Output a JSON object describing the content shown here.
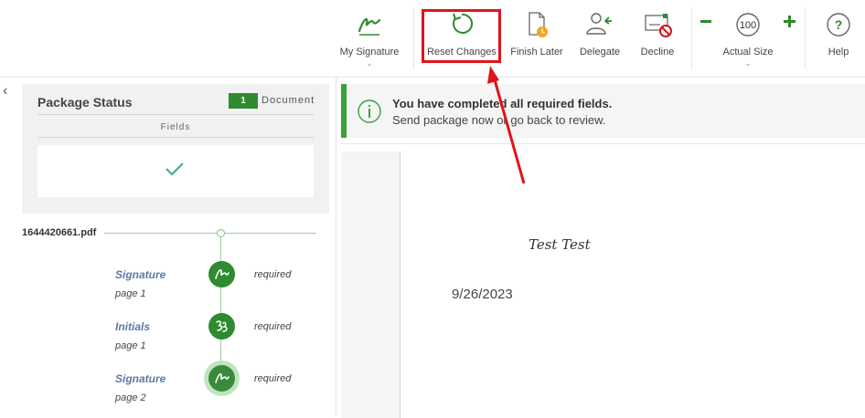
{
  "toolbar": {
    "my_signature": "My Signature",
    "reset_changes": "Reset Changes",
    "finish_later": "Finish Later",
    "delegate": "Delegate",
    "decline": "Decline",
    "zoom_value": "100",
    "actual_size": "Actual Size",
    "help": "Help"
  },
  "package_status": {
    "title": "Package Status",
    "document_count": "1",
    "document_label": "Document",
    "fields_label": "Fields"
  },
  "file": {
    "name": "1644420661.pdf",
    "fields": [
      {
        "name": "Signature",
        "page": "page 1",
        "status": "required"
      },
      {
        "name": "Initials",
        "page": "page 1",
        "status": "required"
      },
      {
        "name": "Signature",
        "page": "page 2",
        "status": "required"
      }
    ]
  },
  "banner": {
    "title": "You have completed all required fields.",
    "subtitle": "Send package now or go back to review."
  },
  "document": {
    "signature_text": "Test Test",
    "date_text": "9/26/2023"
  },
  "colors": {
    "accent_green": "#2e8b2f",
    "annotation_red": "#e0141b",
    "field_link": "#5c79a3"
  }
}
